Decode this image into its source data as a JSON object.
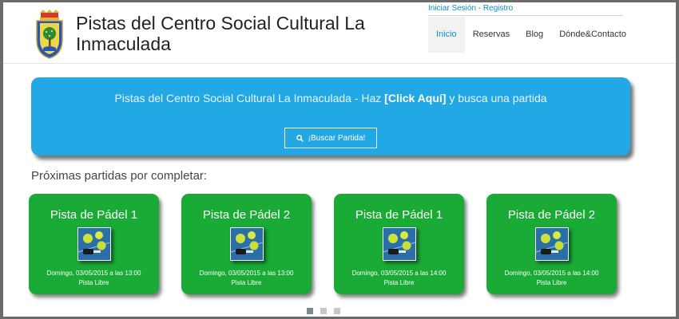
{
  "header": {
    "title_line1": "Pistas del Centro Social Cultural La",
    "title_line2": "Inmaculada",
    "login_label": "Iniciar Sesión",
    "separator": " - ",
    "register_label": "Registro",
    "nav": [
      "Inicio",
      "Reservas",
      "Blog",
      "Dónde&Contacto"
    ]
  },
  "banner": {
    "text_prefix": "Pistas del Centro Social Cultural La Inmaculada - Haz ",
    "text_highlight": "[Click Aquí]",
    "text_suffix": " y busca una partida",
    "button_label": "¡Buscar Partida!"
  },
  "section_title": "Próximas partidas por completar:",
  "cards": [
    {
      "title": "Pista de Pádel 1",
      "date": "Domingo, 03/05/2015 a las 13:00",
      "status": "Pista Libre"
    },
    {
      "title": "Pista de Pádel 2",
      "date": "Domingo, 03/05/2015 a las 13:00",
      "status": "Pista Libre"
    },
    {
      "title": "Pista de Pádel 1",
      "date": "Domingo, 03/05/2015 a las 14:00",
      "status": "Pista Libre"
    },
    {
      "title": "Pista de Pádel 2",
      "date": "Domingo, 03/05/2015 a las 14:00",
      "status": "Pista Libre"
    }
  ],
  "colors": {
    "accent": "#0d8fc9",
    "banner": "#23a8e6",
    "card": "#1aab36"
  },
  "icons": {
    "logo": "coat-of-arms-icon",
    "search": "search-icon",
    "card_image": "padel-balls-icon"
  }
}
